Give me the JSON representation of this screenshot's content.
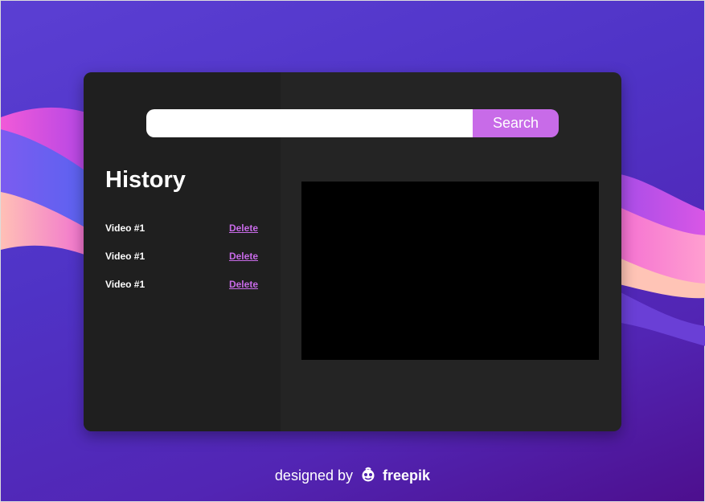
{
  "search": {
    "value": "",
    "placeholder": "",
    "button_label": "Search"
  },
  "history": {
    "title": "History",
    "items": [
      {
        "label": "Video #1",
        "delete_label": "Delete"
      },
      {
        "label": "Video #1",
        "delete_label": "Delete"
      },
      {
        "label": "Video #1",
        "delete_label": "Delete"
      }
    ]
  },
  "credit": {
    "prefix": "designed by",
    "brand": "freepik",
    "logo_icon": "freepik-logo-icon"
  },
  "colors": {
    "accent": "#c86be8",
    "card_bg": "#242424",
    "sidebar_bg": "#1f1f1f",
    "player_bg": "#000000",
    "background_start": "#5b3fd3",
    "background_end": "#4d0f8e"
  }
}
